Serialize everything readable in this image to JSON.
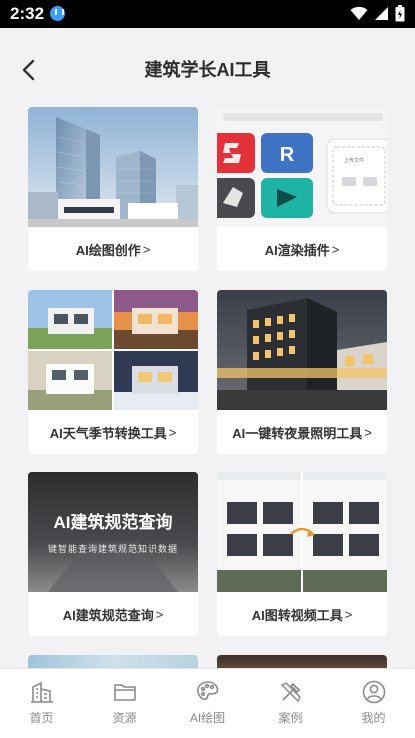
{
  "status_bar": {
    "time": "2:32"
  },
  "header": {
    "title": "建筑学长AI工具"
  },
  "cards": [
    {
      "label": "AI绘图创作",
      "chevron": ">"
    },
    {
      "label": "AI渲染插件",
      "chevron": ">"
    },
    {
      "label": "AI天气季节转换工具",
      "chevron": ">"
    },
    {
      "label": "AI一键转夜景照明工具",
      "chevron": ">"
    },
    {
      "label": "AI建筑规范查询",
      "chevron": ">"
    },
    {
      "label": "AI图转视频工具",
      "chevron": ">"
    }
  ],
  "plugin_panel": {
    "upload_text": "上传文件"
  },
  "spec_banner": {
    "headline": "AI建筑规范查询",
    "subline": "键智能查询建筑规范知识数据"
  },
  "tabs": [
    {
      "label": "首页",
      "icon": "building-icon"
    },
    {
      "label": "资源",
      "icon": "folder-icon"
    },
    {
      "label": "AI绘图",
      "icon": "palette-icon"
    },
    {
      "label": "案例",
      "icon": "tools-icon"
    },
    {
      "label": "我的",
      "icon": "user-icon"
    }
  ],
  "colors": {
    "background": "#f2f2f4",
    "tab_inactive": "#8a8a8a",
    "sketchup_red": "#e5323a",
    "revit_blue": "#3f74c4",
    "teal": "#1fb3a6"
  }
}
